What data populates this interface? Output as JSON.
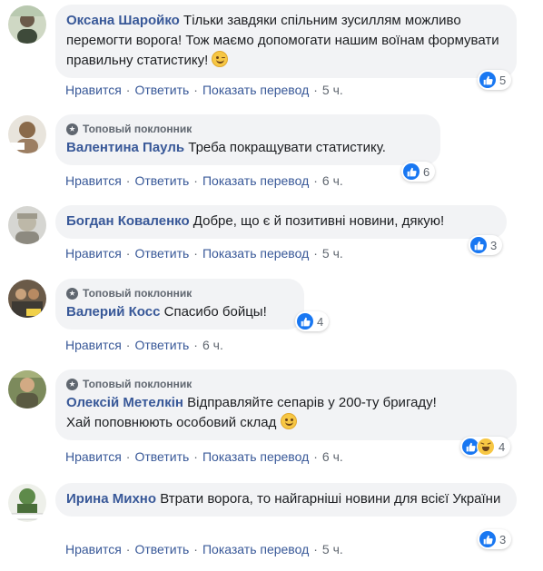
{
  "comments": [
    {
      "author": "Оксана Шаройко",
      "text": "Тільки завдяки спільним зусиллям можливо перемогти ворога! Тож маємо допомогати нашим воїнам формувати правильну статистику!",
      "emoji": "wink-emoji",
      "top_fan": false,
      "actions": {
        "like": "Нравится",
        "reply": "Ответить",
        "translate": "Показать перевод",
        "time": "5 ч."
      },
      "reactions": {
        "types": [
          "like"
        ],
        "count": "5"
      }
    },
    {
      "author": "Валентина Пауль",
      "text": "Треба покращувати статистику.",
      "top_fan": true,
      "top_fan_label": "Топовый поклонник",
      "actions": {
        "like": "Нравится",
        "reply": "Ответить",
        "translate": "Показать перевод",
        "time": "6 ч."
      },
      "reactions": {
        "types": [
          "like"
        ],
        "count": "6"
      }
    },
    {
      "author": "Богдан Коваленко",
      "text": "Добре, що є й позитивні новини, дякую!",
      "top_fan": false,
      "actions": {
        "like": "Нравится",
        "reply": "Ответить",
        "translate": "Показать перевод",
        "time": "5 ч."
      },
      "reactions": {
        "types": [
          "like"
        ],
        "count": "3"
      }
    },
    {
      "author": "Валерий Косс",
      "text": "Спасибо бойцы!",
      "top_fan": true,
      "top_fan_label": "Топовый поклонник",
      "actions": {
        "like": "Нравится",
        "reply": "Ответить",
        "time": "6 ч."
      },
      "reactions": {
        "types": [
          "like"
        ],
        "count": "4"
      }
    },
    {
      "author": "Олексій Метелкін",
      "text_line1": "Відправляйте сепарів у 200-ту бригаду!",
      "text_line2": "Хай поповнюють особовий склад",
      "emoji": "smile-emoji",
      "top_fan": true,
      "top_fan_label": "Топовый поклонник",
      "actions": {
        "like": "Нравится",
        "reply": "Ответить",
        "translate": "Показать перевод",
        "time": "6 ч."
      },
      "reactions": {
        "types": [
          "like",
          "haha"
        ],
        "count": "4"
      }
    },
    {
      "author": "Ирина Михно",
      "text": "Втрати ворога, то найгарніші новини для всієї України",
      "top_fan": false,
      "actions": {
        "like": "Нравится",
        "reply": "Ответить",
        "translate": "Показать перевод",
        "time": "5 ч."
      },
      "reactions": {
        "types": [
          "like"
        ],
        "count": "3"
      }
    }
  ],
  "colors": {
    "link": "#385898",
    "bubble": "#f2f3f5",
    "meta": "#606770",
    "like": "#1877f2"
  }
}
